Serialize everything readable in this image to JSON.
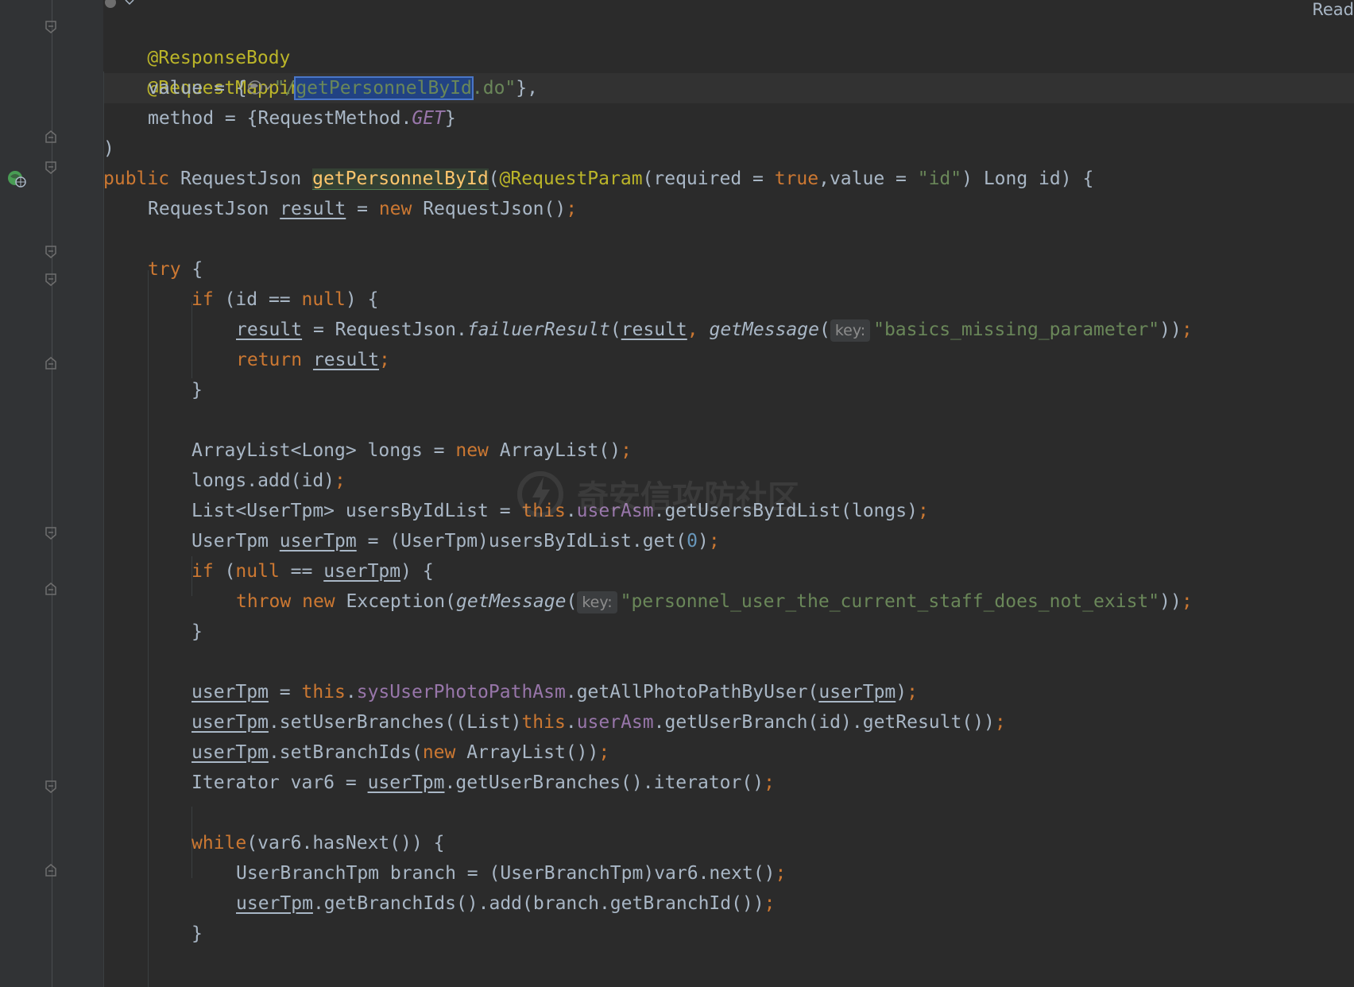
{
  "status": {
    "read_label": "Read"
  },
  "watermark": {
    "text": "奇安信攻防社区"
  },
  "code": {
    "ann_response": "@ResponseBody",
    "ann_request": "@RequestMapping(",
    "value_prefix": "value = {",
    "url_open": "\"/",
    "url_sel": "getPersonnelById",
    "url_rest": ".do\"",
    "value_close": "},",
    "method_prefix": "method = {RequestMethod.",
    "method_get": "GET",
    "method_close": "}",
    "close_paren": ")",
    "public_kw": "public",
    "ret_type": " RequestJson ",
    "method_name": "getPersonnelById",
    "sig_paren": "(",
    "req_param": "@RequestParam",
    "sig_mid1": "(required = ",
    "true_kw": "true",
    "sig_mid2": ",value = ",
    "id_str": "\"id\"",
    "sig_end": ") Long id) {",
    "l_result_type": "RequestJson ",
    "result": "result",
    "eq": " = ",
    "new_kw": "new",
    "l_result_ctor": " RequestJson()",
    "semi": ";",
    "try_kw": "try",
    "try_rest": " {",
    "if_kw": "if",
    "if1_mid": " (id == ",
    "null_kw": "null",
    "if1_end": ") {",
    "fail_mid": " = RequestJson.",
    "fail_fn": "failuerResult",
    "fail_open": "(",
    "comma_sp": ", ",
    "getmsg": "getMessage",
    "key_hint": "key:",
    "msg1": "\"basics_missing_parameter\"",
    "close2": "))",
    "return_kw": "return",
    "brace_close": "}",
    "longs_decl": "ArrayList<Long> longs = ",
    "arraylist_ctor": " ArrayList()",
    "longs_add": "longs.add(id)",
    "list_decl": "List<UserTpm> usersByIdList = ",
    "this_kw": "this",
    "dot": ".",
    "userasm": "userAsm",
    "getusers": ".getUsersByIdList(longs)",
    "usertpm_type": "UserTpm ",
    "userTpm": "userTpm",
    "cast_get": " = (UserTpm)usersByIdList.get(",
    "zero": "0",
    "close1": ")",
    "if2_open": " (",
    "if2_mid": " == ",
    "if2_end": ") {",
    "throw_kw": "throw",
    "exception": " Exception(",
    "msg2": "\"personnel_user_the_current_staff_does_not_exist\"",
    "sysphoto": "sysUserPhotoPathAsm",
    "getphoto": ".getAllPhotoPathByUser(",
    "setbranches": ".setUserBranches((List)",
    "getuserbranch": ".getUserBranch(id).getResult())",
    "setbranchids": ".setBranchIds(",
    "arraylist_ctor2": " ArrayList())",
    "iter_decl": "Iterator var6 = ",
    "iter_rest": ".getUserBranches().iterator()",
    "while_kw": "while",
    "while_rest": "(var6.hasNext()) {",
    "branch_decl": "UserBranchTpm branch = (UserBranchTpm)var6.next()",
    "branch_add": ".getBranchIds().add(branch.getBranchId())"
  }
}
